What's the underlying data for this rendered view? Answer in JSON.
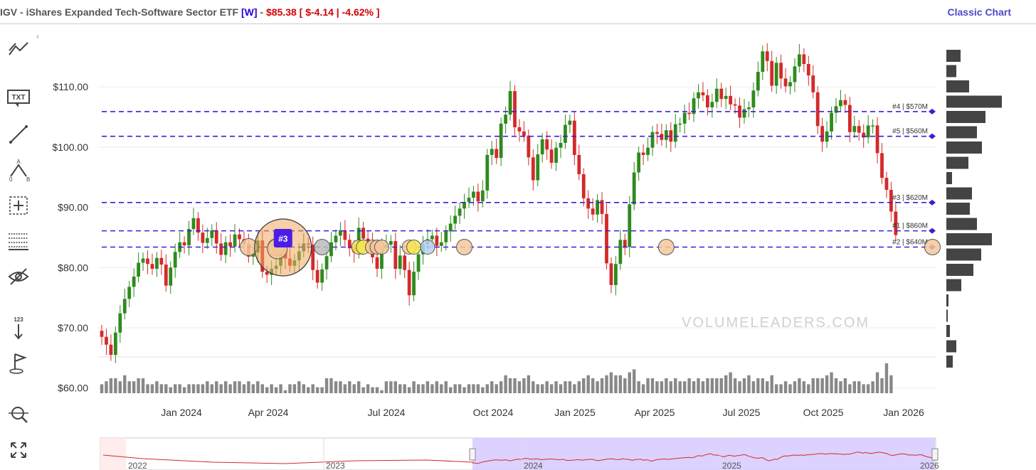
{
  "header": {
    "ticker": "IGV",
    "name": "iShares Expanded Tech-Software Sector ETF",
    "frequency": "[W]",
    "price": "$85.38",
    "change": "[ $-4.14 | -4.62% ]",
    "classic_chart_label": "Classic Chart"
  },
  "toolbar": [
    {
      "icon": "trend-lines-icon"
    },
    {
      "icon": "text-tool-icon",
      "label": "TXT"
    },
    {
      "icon": "line-tool-icon"
    },
    {
      "icon": "abc-pattern-icon",
      "label": "A 0 B"
    },
    {
      "icon": "crosshair-icon"
    },
    {
      "icon": "table-icon"
    },
    {
      "icon": "hide-icon"
    },
    {
      "icon": "sort-numeric-icon",
      "label": "123"
    },
    {
      "icon": "flag-icon"
    },
    {
      "icon": "zoom-icon"
    },
    {
      "icon": "fullscreen-icon"
    }
  ],
  "watermark": "VOLUMELEADERS.COM",
  "colors": {
    "up": "#2e8b1e",
    "down": "#d42a2a",
    "level": "#3a1fd6",
    "volume": "#888888",
    "navigator_line": "#d42a2a",
    "navigator_fill": "#d9ccff"
  },
  "chart_data": {
    "type": "candlestick",
    "ylim": [
      60,
      117
    ],
    "y_ticks": [
      "$110.00",
      "$100.00",
      "$90.00",
      "$80.00",
      "$70.00",
      "$60.00"
    ],
    "x_ticks": [
      "Jan 2024",
      "Apr 2024",
      "Jul 2024",
      "Oct 2024",
      "Jan 2025",
      "Apr 2025",
      "Jul 2025",
      "Oct 2025",
      "Jan 2026"
    ],
    "closes": [
      68.5,
      67.2,
      65.5,
      69.2,
      72.4,
      74.8,
      76.8,
      78.5,
      80.8,
      81.5,
      80.6,
      79.8,
      81.6,
      80.5,
      77.0,
      80.0,
      82.6,
      84.2,
      83.7,
      86.4,
      88.2,
      85.8,
      84.1,
      84.9,
      86.2,
      84.0,
      82.1,
      84.2,
      83.5,
      85.5,
      84.7,
      83.9,
      81.8,
      82.5,
      84.5,
      79.3,
      78.8,
      79.8,
      80.3,
      82.5,
      81.5,
      80.3,
      81.2,
      82.7,
      84.0,
      83.8,
      79.6,
      77.5,
      79.7,
      81.9,
      84.2,
      85.3,
      86.2,
      84.6,
      83.2,
      82.5,
      86.6,
      84.8,
      84.1,
      81.7,
      79.8,
      83.5,
      83.8,
      84.4,
      79.8,
      82.0,
      79.6,
      75.4,
      79.3,
      82.2,
      83.9,
      84.7,
      85.3,
      83.6,
      84.2,
      86.0,
      87.3,
      88.6,
      89.8,
      90.9,
      91.6,
      92.6,
      91.0,
      92.8,
      98.7,
      99.7,
      98.2,
      103.9,
      105.4,
      109.3,
      103.3,
      102.6,
      101.9,
      98.3,
      94.5,
      98.8,
      101.3,
      99.6,
      97.4,
      99.9,
      100.7,
      103.7,
      104.4,
      98.7,
      95.5,
      91.5,
      89.8,
      88.8,
      91.2,
      88.9,
      80.7,
      77.1,
      80.6,
      84.6,
      83.4,
      90.5,
      95.8,
      99.1,
      98.7,
      99.9,
      102.5,
      102.2,
      101.2,
      102.8,
      100.9,
      103.8,
      103.9,
      105.7,
      105.5,
      108.1,
      109.1,
      108.6,
      106.6,
      107.5,
      109.7,
      108.0,
      108.5,
      107.1,
      106.9,
      104.9,
      106.3,
      106.6,
      109.4,
      112.5,
      115.9,
      114.3,
      110.2,
      114.0,
      111.4,
      110.1,
      110.8,
      113.4,
      115.4,
      113.8,
      111.9,
      109.1,
      103.5,
      100.9,
      102.6,
      105.7,
      106.8,
      107.8,
      107.0,
      102.5,
      103.5,
      102.4,
      101.6,
      103.6,
      103.6,
      99.0,
      94.9,
      92.9,
      89.3,
      85.4
    ]
  },
  "volume": [
    3,
    4,
    5,
    5,
    4,
    6,
    4,
    4,
    5,
    5,
    3,
    3,
    4,
    3,
    3,
    2,
    3,
    3,
    2,
    3,
    3,
    3,
    3,
    4,
    3,
    4,
    3,
    4,
    3,
    4,
    4,
    3,
    4,
    3,
    4,
    3,
    2,
    3,
    2,
    3,
    1,
    3,
    3,
    4,
    3,
    2,
    3,
    2,
    2,
    5,
    5,
    4,
    4,
    3,
    4,
    3,
    4,
    2,
    3,
    2,
    2,
    1,
    4,
    4,
    4,
    3,
    3,
    2,
    4,
    3,
    3,
    4,
    3,
    4,
    3,
    4,
    2,
    3,
    3,
    2,
    3,
    3,
    3,
    2,
    3,
    4,
    3,
    4,
    6,
    5,
    5,
    4,
    5,
    6,
    4,
    3,
    3,
    4,
    3,
    4,
    3,
    4,
    4,
    3,
    4,
    5,
    6,
    5,
    4,
    5,
    6,
    7,
    6,
    6,
    5,
    7,
    8,
    4,
    3,
    5,
    5,
    4,
    4,
    5,
    4,
    5,
    4,
    4,
    5,
    4,
    5,
    4,
    5,
    5,
    5,
    5,
    6,
    7,
    5,
    4,
    5,
    6,
    4,
    5,
    5,
    4,
    6,
    3,
    3,
    4,
    3,
    4,
    5,
    4,
    3,
    5,
    5,
    5,
    6,
    7,
    5,
    4,
    5,
    3,
    4,
    4,
    3,
    3,
    4,
    7,
    5,
    10,
    6
  ],
  "levels": [
    {
      "label": "#4 | $570M",
      "price": 105.9
    },
    {
      "label": "#5 | $560M",
      "price": 101.8
    },
    {
      "label": "#3 | $620M",
      "price": 90.8
    },
    {
      "label": "#1 | $860M",
      "price": 86.1
    },
    {
      "label": "#2 | $640M",
      "price": 83.4
    }
  ],
  "marker_label": "#3",
  "volume_profile": [
    20,
    14,
    32,
    78,
    55,
    43,
    50,
    31,
    8,
    36,
    33,
    43,
    64,
    49,
    38,
    21,
    3,
    2,
    5,
    14,
    9
  ],
  "navigator": {
    "years": [
      "2022",
      "2023",
      "2024",
      "2025",
      "2026"
    ]
  }
}
